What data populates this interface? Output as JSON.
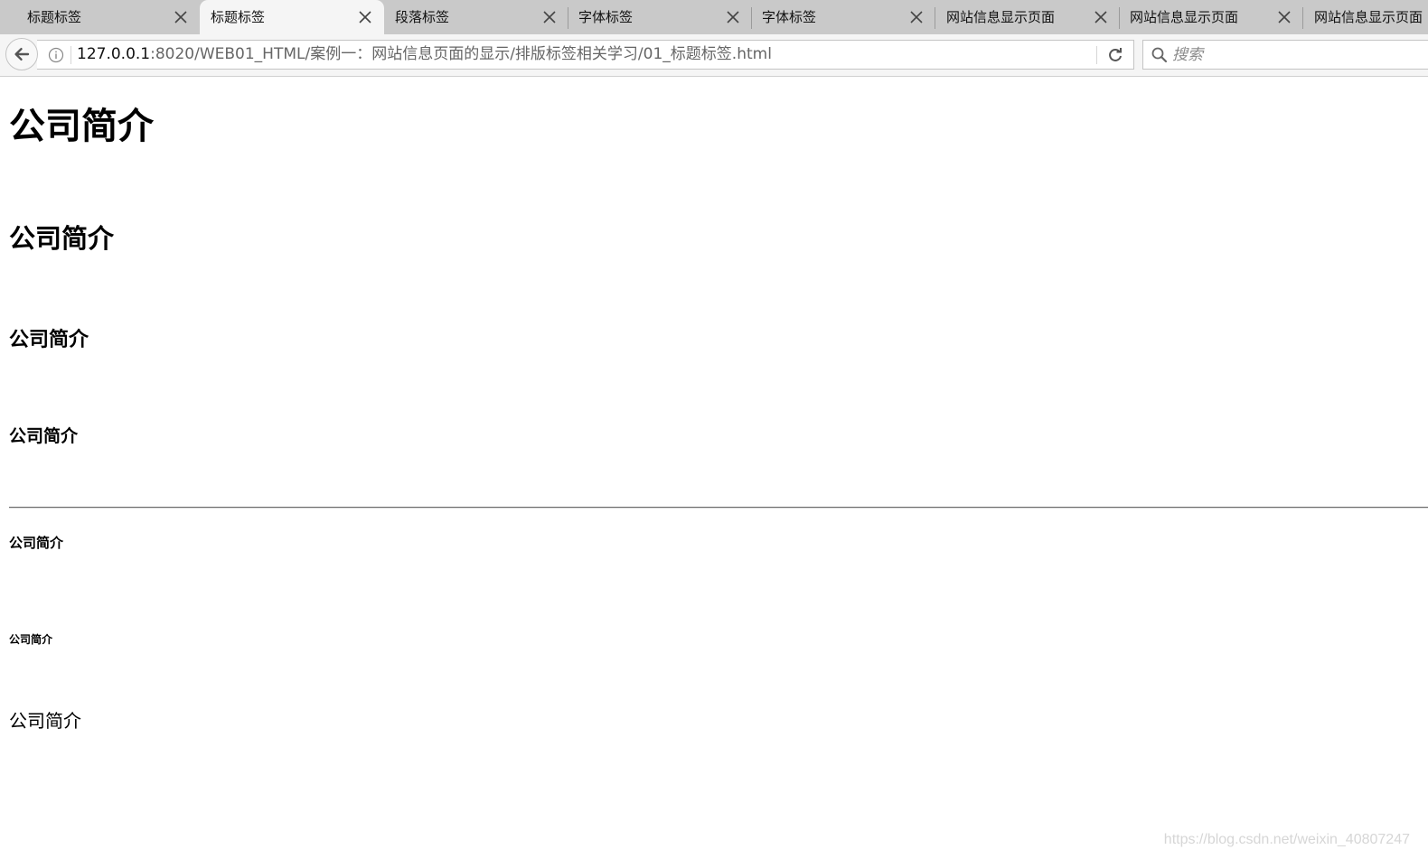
{
  "tabs": [
    {
      "label": "标题标签",
      "active": false
    },
    {
      "label": "标题标签",
      "active": true
    },
    {
      "label": "段落标签",
      "active": false
    },
    {
      "label": "字体标签",
      "active": false
    },
    {
      "label": "字体标签",
      "active": false
    },
    {
      "label": "网站信息显示页面",
      "active": false
    },
    {
      "label": "网站信息显示页面",
      "active": false
    },
    {
      "label": "网站信息显示页面",
      "active": false
    }
  ],
  "navbar": {
    "url_host": "127.0.0.1",
    "url_rest": ":8020/WEB01_HTML/案例一：网站信息页面的显示/排版标签相关学习/01_标题标签.html",
    "search_placeholder": "搜索"
  },
  "page": {
    "h1": "公司简介",
    "h2": "公司简介",
    "h3": "公司简介",
    "h4": "公司简介",
    "h5": "公司简介",
    "h6": "公司简介",
    "plain_text": "公司简介"
  },
  "watermark": "https://blog.csdn.net/weixin_40807247",
  "icons": {
    "back": "back-arrow-icon",
    "info": "info-icon",
    "reload": "reload-icon",
    "search": "search-icon",
    "close": "close-icon"
  },
  "colors": {
    "tabstrip_bg": "#c9c9c9",
    "active_tab_bg": "#f5f5f5",
    "navbar_bg": "#f5f5f5"
  }
}
